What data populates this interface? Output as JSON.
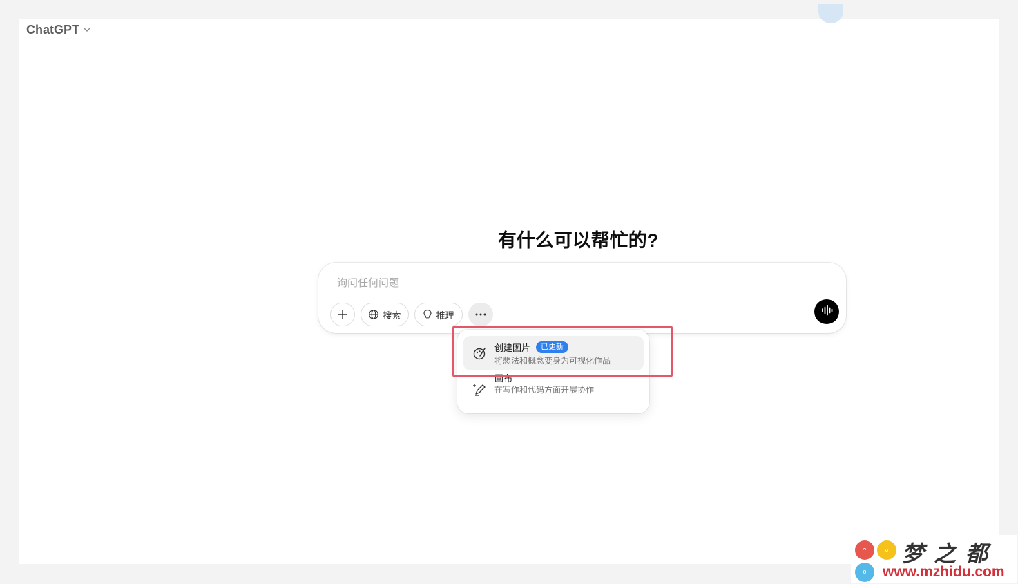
{
  "header": {
    "model_name": "ChatGPT",
    "model_chevron_icon": "chevron-down-icon",
    "avatar_icon": "user-avatar"
  },
  "main": {
    "headline": "有什么可以帮忙的?"
  },
  "composer": {
    "placeholder": "询问任何问题",
    "tools": [
      {
        "icon": "plus-icon",
        "label": ""
      },
      {
        "icon": "globe-icon",
        "label": "搜索"
      },
      {
        "icon": "lightbulb-icon",
        "label": "推理"
      },
      {
        "icon": "more-dots-icon",
        "label": ""
      }
    ],
    "voice_icon": "voice-wave-icon"
  },
  "menu": {
    "items": [
      {
        "icon": "image-create-icon",
        "title": "创建图片",
        "badge": "已更新",
        "description": "将想法和概念变身为可视化作品"
      },
      {
        "icon": "pen-sparkle-icon",
        "title": "画布",
        "description": "在写作和代码方面开展协作"
      }
    ]
  },
  "watermark": {
    "title": "梦之都",
    "url": "www.mzhidu.com"
  },
  "colors": {
    "badge": "#2f80ed",
    "highlight": "#e4566a",
    "voice_button": "#000000"
  }
}
